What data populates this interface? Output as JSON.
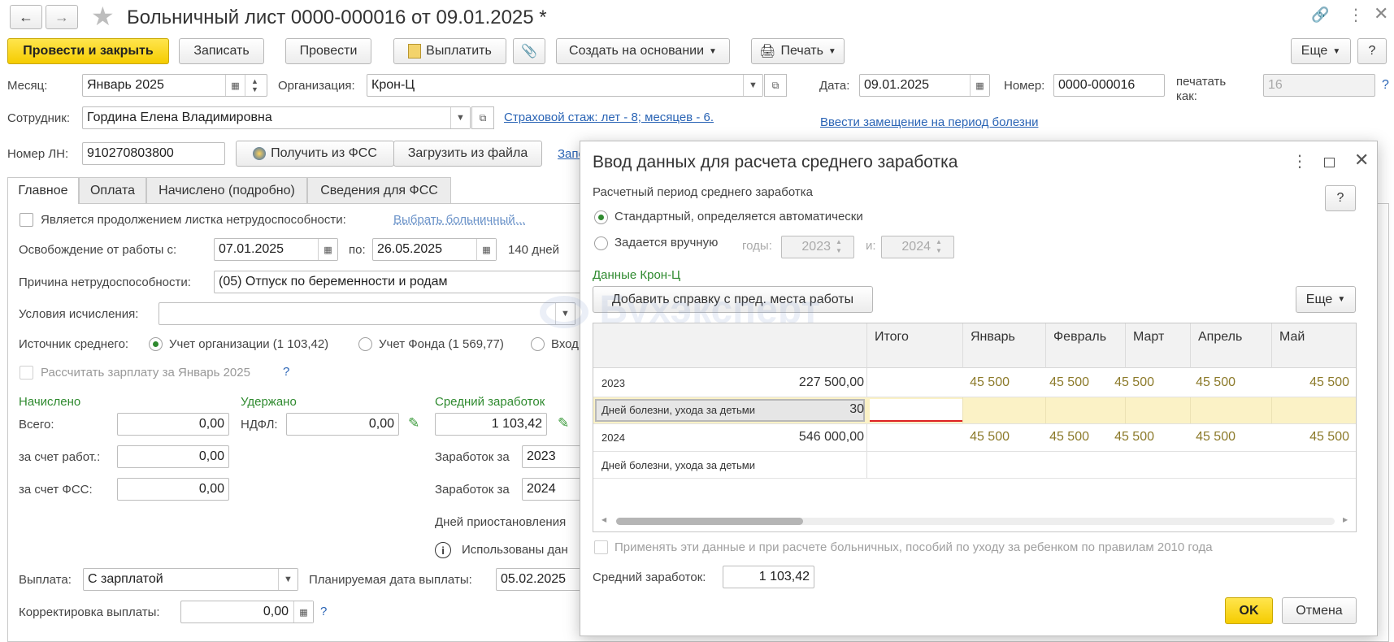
{
  "window": {
    "title": "Больничный лист 0000-000016 от 09.01.2025 *"
  },
  "toolbar": {
    "post_close": "Провести и закрыть",
    "save": "Записать",
    "post": "Провести",
    "pay": "Выплатить",
    "create_based": "Создать на основании",
    "print": "Печать",
    "more": "Еще",
    "help": "?"
  },
  "form": {
    "month_label": "Месяц:",
    "month_value": "Январь 2025",
    "org_label": "Организация:",
    "org_value": "Крон-Ц",
    "date_label": "Дата:",
    "date_value": "09.01.2025",
    "number_label": "Номер:",
    "number_value": "0000-000016",
    "print_as_label_1": "печатать",
    "print_as_label_2": "как:",
    "print_as_value": "16",
    "help_q": "?",
    "employee_label": "Сотрудник:",
    "employee_value": "Гордина Елена Владимировна",
    "insurance_link": "Страховой стаж: лет - 8; месяцев - 6.",
    "replacement_link": "Ввести замещение на период болезни",
    "ln_label": "Номер ЛН:",
    "ln_value": "910270803800",
    "get_fss": "Получить из ФСС",
    "load_file": "Загрузить из файла",
    "cut_link": "Запо"
  },
  "tabs": [
    "Главное",
    "Оплата",
    "Начислено (подробно)",
    "Сведения для ФСС"
  ],
  "main": {
    "continuation_label": "Является продолжением листка нетрудоспособности:",
    "choose_link": "Выбрать больничный...",
    "release_label": "Освобождение от работы с:",
    "release_from": "07.01.2025",
    "to_label": "по:",
    "release_to": "26.05.2025",
    "days": "140 дней",
    "reason_label": "Причина нетрудоспособности:",
    "reason_value": "(05) Отпуск по беременности и родам",
    "conditions_label": "Условия исчисления:",
    "conditions_value": "",
    "source_label": "Источник среднего:",
    "source_org": "Учет организации (1 103,42)",
    "source_fund": "Учет Фонда (1 569,77)",
    "source_input": "Вход",
    "calc_salary": "Рассчитать зарплату за Январь 2025",
    "calc_q": "?",
    "accrued_title": "Начислено",
    "withheld_title": "Удержано",
    "avg_title": "Средний заработок",
    "total_label": "Всего:",
    "total_value": "0,00",
    "ndfl_label": "НДФЛ:",
    "ndfl_value": "0,00",
    "avg_value": "1 103,42",
    "employer_label": "за счет работ.:",
    "employer_value": "0,00",
    "fss_label": "за счет ФСС:",
    "fss_value": "0,00",
    "earnings_label": "Заработок за",
    "earnings_year1": "2023",
    "earnings_year2": "2024",
    "suspended_label": "Дней приостановления",
    "used_data": "Использованы дан",
    "payout_label": "Выплата:",
    "payout_value": "С зарплатой",
    "planned_label": "Планируемая дата выплаты:",
    "planned_value": "05.02.2025",
    "correction_label": "Корректировка выплаты:",
    "correction_value": "0,00",
    "correction_q": "?"
  },
  "modal": {
    "title": "Ввод данных для расчета среднего заработка",
    "period_label": "Расчетный период среднего заработка",
    "help": "?",
    "opt_standard": "Стандартный, определяется автоматически",
    "opt_manual": "Задается вручную",
    "years_label": "годы:",
    "year_from": "2023",
    "and_label": "и:",
    "year_to": "2024",
    "data_title": "Данные Крон-Ц",
    "add_cert": "Добавить справку с пред. места работы",
    "more": "Еще",
    "watermark": "Бухэксперт",
    "columns": [
      "Итого",
      "Январь",
      "Февраль",
      "Март",
      "Апрель",
      "Май"
    ],
    "rows": [
      {
        "label": "2023",
        "total": "227 500,00",
        "months": [
          "45 500",
          "45 500",
          "45 500",
          "45 500",
          "45 500"
        ]
      },
      {
        "label": "Дней болезни, ухода за детьми",
        "total": "30",
        "months": [
          "",
          "",
          "",
          "",
          ""
        ]
      },
      {
        "label": "2024",
        "total": "546 000,00",
        "months": [
          "45 500",
          "45 500",
          "45 500",
          "45 500",
          "45 500"
        ]
      },
      {
        "label": "Дней болезни, ухода за детьми",
        "total": "",
        "months": [
          "",
          "",
          "",
          "",
          ""
        ]
      }
    ],
    "apply_label": "Применять эти данные и при расчете больничных, пособий по уходу за ребенком по правилам 2010 года",
    "avg_label": "Средний заработок:",
    "avg_value": "1 103,42",
    "ok": "OK",
    "cancel": "Отмена"
  }
}
